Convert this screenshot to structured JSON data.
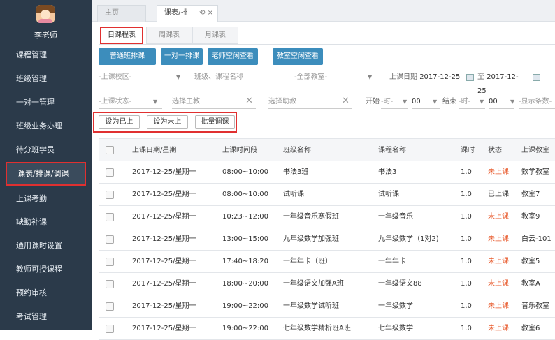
{
  "sidebar": {
    "username": "李老师",
    "items": [
      {
        "label": "课程管理"
      },
      {
        "label": "班级管理"
      },
      {
        "label": "一对一管理"
      },
      {
        "label": "班级业务办理"
      },
      {
        "label": "待分班学员"
      },
      {
        "label": "课表/排课/调课",
        "active": true
      },
      {
        "label": "上课考勤"
      },
      {
        "label": "缺勤补课"
      },
      {
        "label": "通用课时设置"
      },
      {
        "label": "教师可授课程"
      },
      {
        "label": "预约审核"
      },
      {
        "label": "考试管理"
      }
    ]
  },
  "top_tabs": [
    {
      "label": "主页"
    },
    {
      "label": "课表/排",
      "close": "⟲ ×"
    }
  ],
  "view_tabs": [
    "日课程表",
    "周课表",
    "月课表"
  ],
  "buttons": [
    "普通班排课",
    "一对一排课",
    "老师空闲查看",
    "教室空闲查看"
  ],
  "filters": {
    "campus": "-上课校区-",
    "class_course": "班级、课程名称",
    "classroom": "-全部教室-",
    "date_label": "上课日期",
    "date_from": "2017-12-25",
    "date_to_label": "至",
    "date_to": "2017-12-25",
    "status": "-上课状态-",
    "main_teacher": "选择主教",
    "assistant": "选择助教",
    "start_label": "开始",
    "hour": "-时-",
    "minute": "00",
    "end_label": "结束",
    "end_hour": "-时-",
    "end_minute": "00",
    "page_size": "-显示条数-"
  },
  "actions": [
    "设为已上",
    "设为未上",
    "批量调课"
  ],
  "table": {
    "headers": [
      "上课日期/星期",
      "上课时间段",
      "班级名称",
      "课程名称",
      "课时",
      "状态",
      "上课教室"
    ],
    "rows": [
      [
        "2017-12-25/星期一",
        "08:00~10:00",
        "书法3班",
        "书法3",
        "1.0",
        "未上课",
        "数学教室"
      ],
      [
        "2017-12-25/星期一",
        "08:00~10:00",
        "试听课",
        "试听课",
        "1.0",
        "已上课",
        "教室7"
      ],
      [
        "2017-12-25/星期一",
        "10:23~12:00",
        "一年级音乐寒假班",
        "一年级音乐",
        "1.0",
        "未上课",
        "教室9"
      ],
      [
        "2017-12-25/星期一",
        "13:00~15:00",
        "九年级数学加强班",
        "九年级数学（1对2)",
        "1.0",
        "未上课",
        "白云-101"
      ],
      [
        "2017-12-25/星期一",
        "17:40~18:20",
        "一年年卡（班）",
        "一年年卡",
        "1.0",
        "未上课",
        "教室5"
      ],
      [
        "2017-12-25/星期一",
        "18:00~20:00",
        "一年级语文加强A班",
        "一年级语文88",
        "1.0",
        "未上课",
        "教室A"
      ],
      [
        "2017-12-25/星期一",
        "19:00~22:00",
        "一年级数学试听班",
        "一年级数学",
        "1.0",
        "未上课",
        "音乐教室"
      ],
      [
        "2017-12-25/星期一",
        "19:00~22:00",
        "七年级数学精析班A班",
        "七年级数学",
        "1.0",
        "未上课",
        "教室6"
      ]
    ]
  },
  "colors": {
    "sidebar": "#2b3a4a",
    "primary": "#3c8dbc",
    "highlight": "#e03030",
    "status_pending": "#e85a2c"
  }
}
